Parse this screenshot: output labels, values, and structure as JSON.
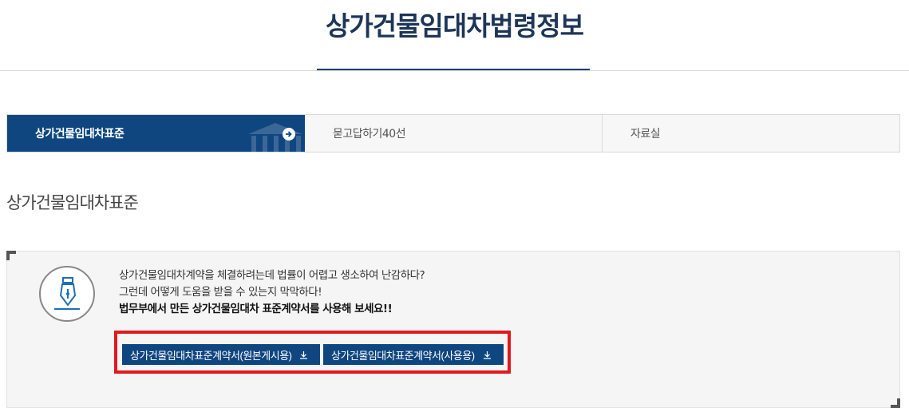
{
  "page": {
    "title": "상가건물임대차법령정보"
  },
  "tabs": [
    {
      "label": "상가건물임대차표준",
      "active": true
    },
    {
      "label": "묻고답하기40선",
      "active": false
    },
    {
      "label": "자료실",
      "active": false
    }
  ],
  "section": {
    "heading": "상가건물임대차표준"
  },
  "info": {
    "line1": "상가건물임대차계약을 체결하려는데 법률이 어렵고 생소하여 난감하다?",
    "line2": "그런데 어떻게 도움을 받을 수 있는지 막막하다!",
    "line3": "법무부에서 만든 상가건물임대차 표준계약서를 사용해 보세요!!"
  },
  "buttons": {
    "download_original": "상가건물임대차표준계약서(원본게시용)",
    "download_usage": "상가건물임대차표준계약서(사용용)"
  },
  "colors": {
    "primary": "#0f4680",
    "title": "#1d3557",
    "highlight": "#e0191e"
  },
  "icons": {
    "tab_arrow": "arrow-right-circle-icon",
    "tab_background": "building-icon",
    "info": "fountain-pen-icon",
    "download": "download-icon"
  }
}
